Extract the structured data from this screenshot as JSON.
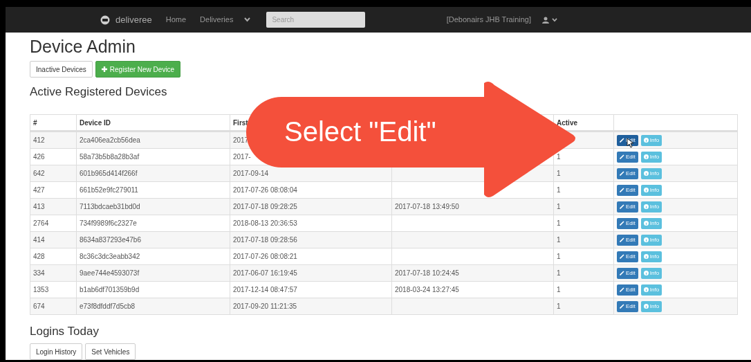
{
  "navbar": {
    "brand": "deliveree",
    "links": [
      {
        "label": "Home"
      },
      {
        "label": "Deliveries"
      }
    ],
    "search": {
      "placeholder": "Search"
    },
    "account": "[Debonairs JHB Training]"
  },
  "page": {
    "title": "Device Admin",
    "buttons": [
      {
        "label": "Inactive Devices",
        "kind": "default"
      },
      {
        "label": "Register New Device",
        "kind": "success"
      }
    ]
  },
  "devices": {
    "title": "Active Registered Devices",
    "columns": [
      "#",
      "Device ID",
      "First",
      "",
      "Active",
      ""
    ],
    "rows": [
      {
        "cells": [
          "412",
          "2ca406ea2cb56dea",
          "2017",
          "",
          ""
        ],
        "edit": "Edit",
        "info": "Info",
        "edit_hovered": true
      },
      {
        "cells": [
          "426",
          "58a73b5b8a28b3af",
          "2017-",
          "",
          "1"
        ],
        "edit": "Edit",
        "info": "Info",
        "edit_hovered": false
      },
      {
        "cells": [
          "642",
          "601b965d414f266f",
          "2017-09-14",
          "",
          "1"
        ],
        "edit": "Edit",
        "info": "Info",
        "edit_hovered": false
      },
      {
        "cells": [
          "427",
          "661b52e9fc279011",
          "2017-07-26 08:08:04",
          "",
          "1"
        ],
        "edit": "Edit",
        "info": "Info",
        "edit_hovered": false
      },
      {
        "cells": [
          "413",
          "7113bdcaeb31bd0d",
          "2017-07-18 09:28:25",
          "2017-07-18 13:49:50",
          "1"
        ],
        "edit": "Edit",
        "info": "Info",
        "edit_hovered": false
      },
      {
        "cells": [
          "2764",
          "734f9989f6c2327e",
          "2018-08-13 20:36:53",
          "",
          "1"
        ],
        "edit": "Edit",
        "info": "Info",
        "edit_hovered": false
      },
      {
        "cells": [
          "414",
          "8634a837293e47b6",
          "2017-07-18 09:28:56",
          "",
          "1"
        ],
        "edit": "Edit",
        "info": "Info",
        "edit_hovered": false
      },
      {
        "cells": [
          "428",
          "8c36c3dc3eabb342",
          "2017-07-26 08:08:21",
          "",
          "1"
        ],
        "edit": "Edit",
        "info": "Info",
        "edit_hovered": false
      },
      {
        "cells": [
          "334",
          "9aee744e4593073f",
          "2017-06-07 16:19:45",
          "2017-07-18 10:24:45",
          "1"
        ],
        "edit": "Edit",
        "info": "Info",
        "edit_hovered": false
      },
      {
        "cells": [
          "1353",
          "b1ab6df701359b9d",
          "2017-12-14 08:47:57",
          "2018-03-24 13:27:45",
          "1"
        ],
        "edit": "Edit",
        "info": "Info",
        "edit_hovered": false
      },
      {
        "cells": [
          "674",
          "e73f8dfddf7d5cb8",
          "2017-09-20 11:21:35",
          "",
          "1"
        ],
        "edit": "Edit",
        "info": "Info",
        "edit_hovered": false
      }
    ]
  },
  "logins": {
    "title": "Logins Today",
    "buttons": [
      "Login History",
      "Set Vehicles"
    ]
  },
  "callout": {
    "text": "Select \"Edit\""
  }
}
